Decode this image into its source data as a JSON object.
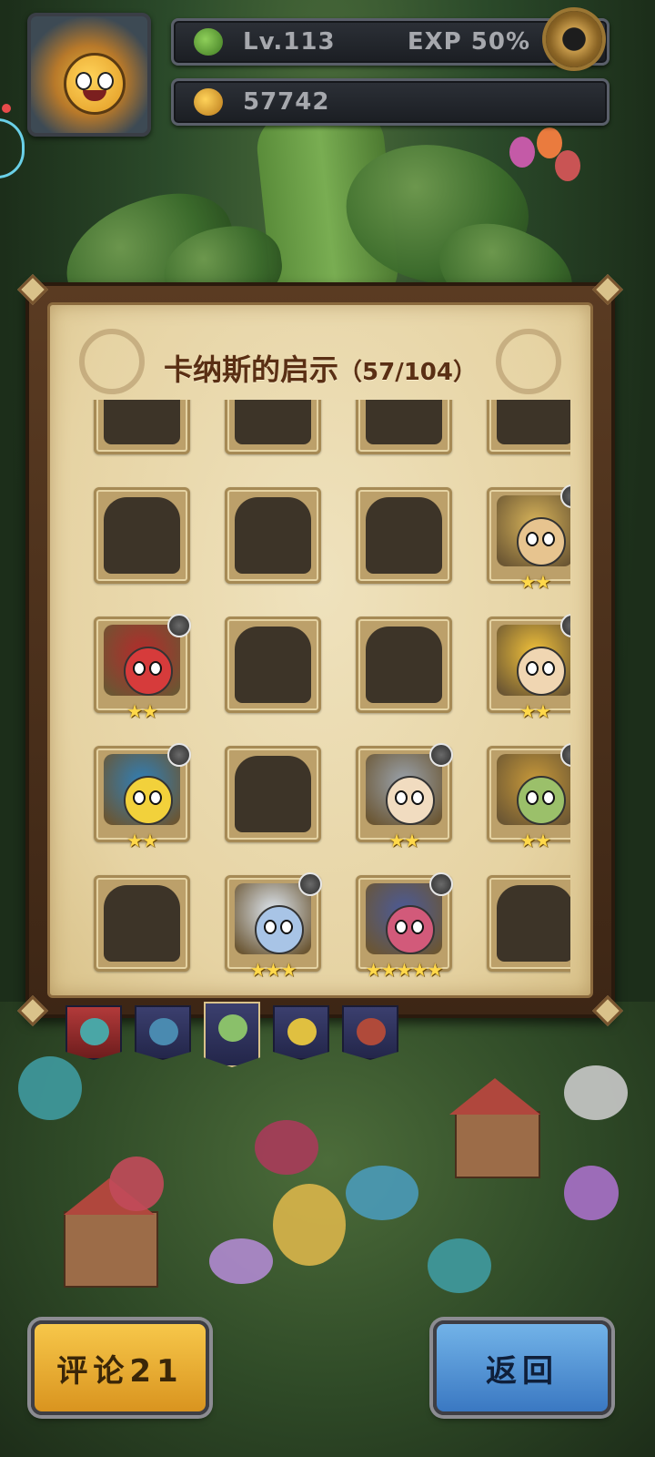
{
  "hud": {
    "level_label": "Lv.113",
    "exp_label": "EXP 50%",
    "gold_amount": "57742"
  },
  "collection": {
    "title": "卡纳斯的启示",
    "count": "（57/104）",
    "rows": [
      [
        {
          "state": "locked"
        },
        {
          "state": "locked"
        },
        {
          "state": "locked"
        },
        {
          "state": "locked"
        }
      ],
      [
        {
          "state": "locked"
        },
        {
          "state": "locked"
        },
        {
          "state": "locked"
        },
        {
          "state": "owned",
          "stars": "★★",
          "theme": "#d8b45a",
          "face": "#e7c48f"
        }
      ],
      [
        {
          "state": "owned",
          "stars": "★★",
          "theme": "#b32b2b",
          "face": "#d63b3b"
        },
        {
          "state": "locked"
        },
        {
          "state": "locked"
        },
        {
          "state": "owned",
          "stars": "★★",
          "theme": "#f2c23a",
          "face": "#f0d6b2"
        }
      ],
      [
        {
          "state": "owned",
          "stars": "★★",
          "theme": "#2f7fb8",
          "face": "#f2d13b"
        },
        {
          "state": "locked"
        },
        {
          "state": "owned",
          "stars": "★★",
          "theme": "#9aa3ad",
          "face": "#f1dcc0"
        },
        {
          "state": "owned",
          "stars": "★★",
          "theme": "#c99a3a",
          "face": "#9bc06a"
        }
      ],
      [
        {
          "state": "locked"
        },
        {
          "state": "owned",
          "stars": "★★★",
          "theme": "#dfe8f2",
          "face": "#a8c4e6"
        },
        {
          "state": "owned",
          "stars": "★★★★★",
          "theme": "#4a5a9a",
          "face": "#d25a7a"
        },
        {
          "state": "locked"
        }
      ]
    ]
  },
  "buttons": {
    "comment_label": "评论21",
    "back_label": "返回"
  }
}
